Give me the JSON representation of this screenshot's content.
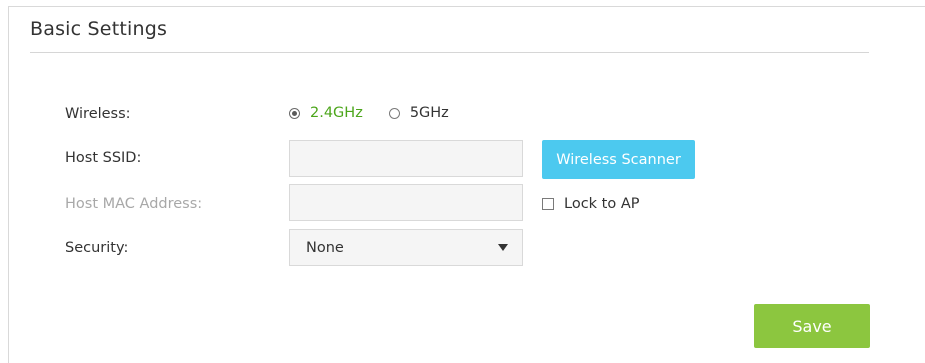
{
  "section": {
    "title": "Basic Settings"
  },
  "form": {
    "wireless": {
      "label": "Wireless:",
      "options": [
        {
          "label": "2.4GHz",
          "selected": true
        },
        {
          "label": "5GHz",
          "selected": false
        }
      ]
    },
    "host_ssid": {
      "label": "Host SSID:",
      "value": ""
    },
    "host_mac": {
      "label": "Host MAC Address:",
      "value": ""
    },
    "security": {
      "label": "Security:",
      "value": "None"
    },
    "scanner_button": "Wireless Scanner",
    "lock_to_ap": {
      "label": "Lock to AP",
      "checked": false
    },
    "save_button": "Save"
  },
  "colors": {
    "active_radio_text": "#4ca61b",
    "scanner_button": "#4cc9ef",
    "save_button": "#8cc63f",
    "disabled_label": "#a8a8a8"
  }
}
